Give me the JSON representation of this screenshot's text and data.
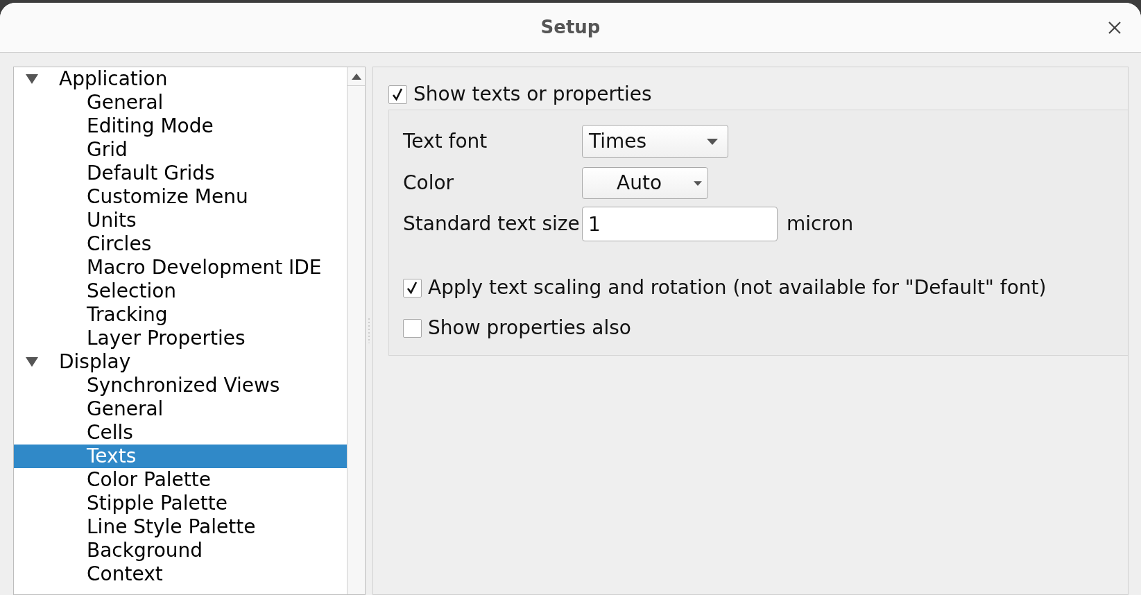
{
  "window": {
    "title": "Setup"
  },
  "tree": [
    {
      "label": "Application",
      "expanded": true,
      "selected": false,
      "children": [
        {
          "label": "General",
          "selected": false
        },
        {
          "label": "Editing Mode",
          "selected": false
        },
        {
          "label": "Grid",
          "selected": false
        },
        {
          "label": "Default Grids",
          "selected": false
        },
        {
          "label": "Customize Menu",
          "selected": false
        },
        {
          "label": "Units",
          "selected": false
        },
        {
          "label": "Circles",
          "selected": false
        },
        {
          "label": "Macro Development IDE",
          "selected": false
        },
        {
          "label": "Selection",
          "selected": false
        },
        {
          "label": "Tracking",
          "selected": false
        },
        {
          "label": "Layer Properties",
          "selected": false
        }
      ]
    },
    {
      "label": "Display",
      "expanded": true,
      "selected": false,
      "children": [
        {
          "label": "Synchronized Views",
          "selected": false
        },
        {
          "label": "General",
          "selected": false
        },
        {
          "label": "Cells",
          "selected": false
        },
        {
          "label": "Texts",
          "selected": true
        },
        {
          "label": "Color Palette",
          "selected": false
        },
        {
          "label": "Stipple Palette",
          "selected": false
        },
        {
          "label": "Line Style Palette",
          "selected": false
        },
        {
          "label": "Background",
          "selected": false
        },
        {
          "label": "Context",
          "selected": false
        }
      ]
    }
  ],
  "group": {
    "label": "Show texts or properties",
    "checked": true
  },
  "text_font": {
    "label": "Text font",
    "value": "Times"
  },
  "color": {
    "label": "Color",
    "value": "Auto"
  },
  "text_size": {
    "label": "Standard text size",
    "value": "1",
    "unit": "micron"
  },
  "options": [
    {
      "label": "Apply text scaling and rotation (not available for \"Default\" font)",
      "checked": true
    },
    {
      "label": "Show properties also",
      "checked": false
    }
  ]
}
